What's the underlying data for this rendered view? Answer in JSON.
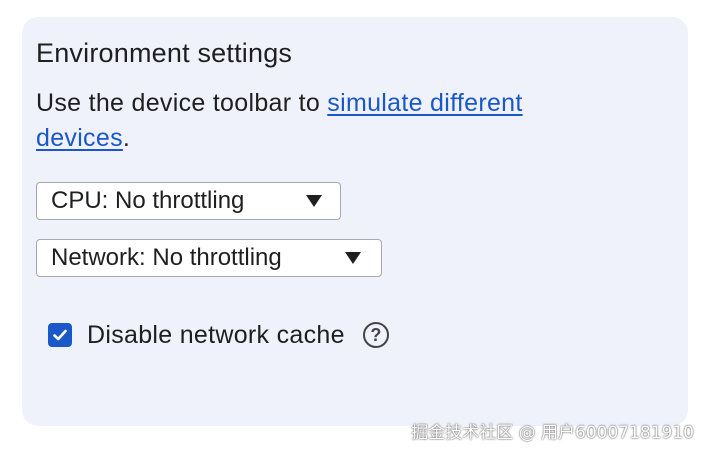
{
  "section": {
    "title": "Environment settings",
    "description_prefix": "Use the device toolbar to ",
    "description_link": "simulate different devices",
    "description_suffix": "."
  },
  "selects": {
    "cpu": {
      "value": "CPU: No throttling"
    },
    "network": {
      "value": "Network: No throttling"
    }
  },
  "checkbox": {
    "label": "Disable network cache",
    "checked": true,
    "help_icon_text": "?"
  },
  "watermark": "掘金技术社区 @ 用户60007181910",
  "colors": {
    "panel_bg": "#eff2fb",
    "accent": "#1a57c9",
    "text": "#1f1f1f"
  },
  "icons": {
    "dropdown": "triangle-down-icon",
    "check": "checkmark-icon",
    "help": "question-circle-icon"
  }
}
